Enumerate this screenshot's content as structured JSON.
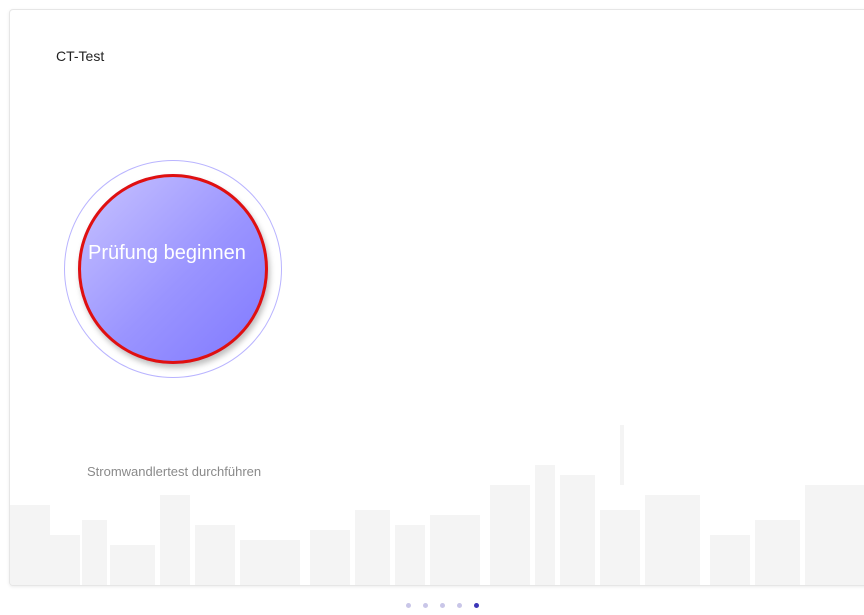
{
  "card": {
    "title": "CT-Test",
    "start_button_label": "Prüfung beginnen",
    "description": "Stromwandlertest durchführen"
  },
  "pagination": {
    "total": 5,
    "active_index": 4
  },
  "colors": {
    "button_gradient_start": "#c9c4ff",
    "button_gradient_end": "#7f78ff",
    "highlight_outline": "#e01010",
    "active_dot": "#3b36b8",
    "inactive_dot": "#c9c6e8"
  }
}
